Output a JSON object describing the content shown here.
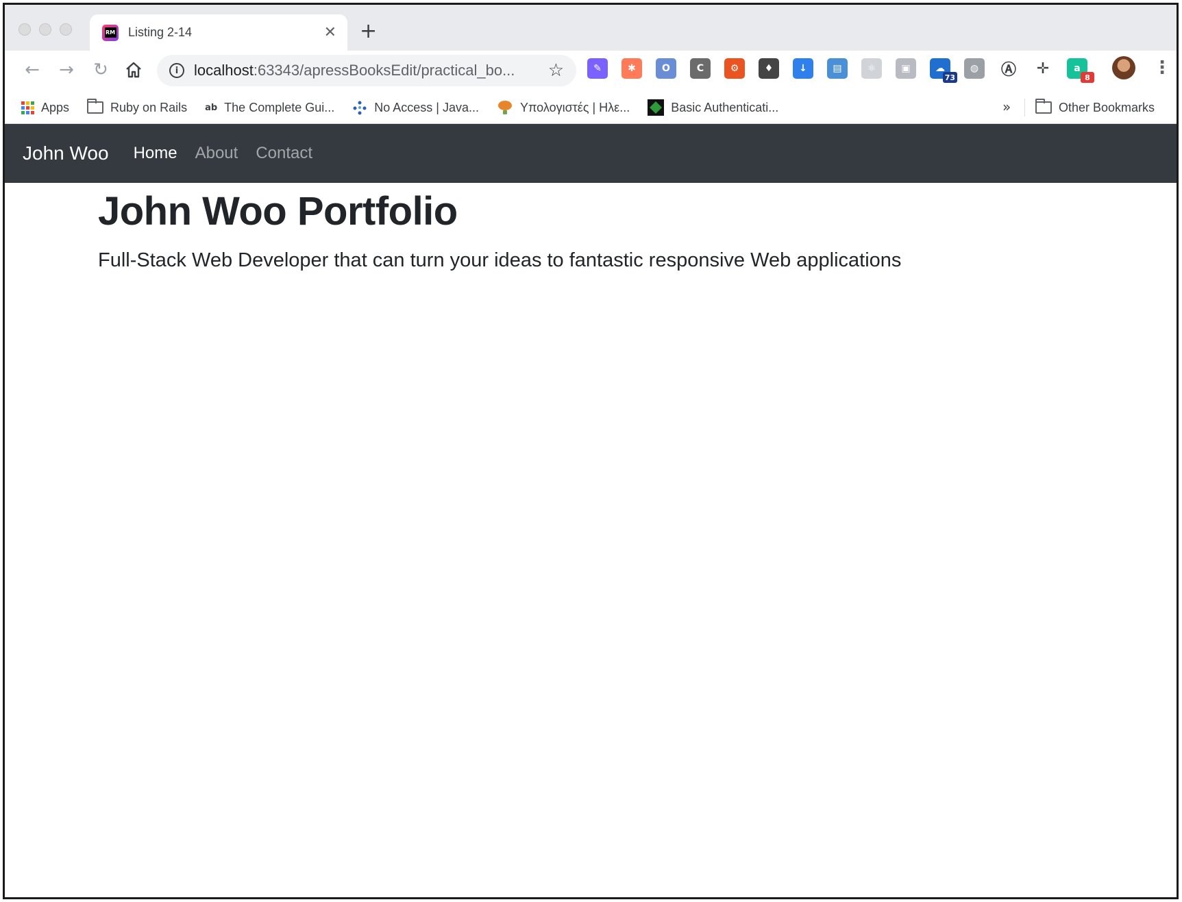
{
  "browser": {
    "tab": {
      "title": "Listing 2-14",
      "favicon_text": "RM",
      "close_glyph": "✕"
    },
    "new_tab_glyph": "+",
    "toolbar": {
      "back_icon": "arrow-left-icon",
      "forward_icon": "arrow-right-icon",
      "reload_icon": "reload-icon",
      "home_icon": "home-icon",
      "url_host": "localhost",
      "url_rest": ":63343/apressBooksEdit/practical_bo...",
      "star_icon": "star-icon",
      "extensions": [
        {
          "icon": "eyedropper-icon",
          "color": "#7b61ff",
          "text": "✎"
        },
        {
          "icon": "hubspot-icon",
          "color": "#ff7a59",
          "text": "✱"
        },
        {
          "icon": "opera-icon",
          "color": "#6a8ed6",
          "text": "O"
        },
        {
          "icon": "c-icon",
          "color": "#6b6b6b",
          "text": "C"
        },
        {
          "icon": "ubuntu-icon",
          "color": "#e95420",
          "text": "⚙"
        },
        {
          "icon": "lightbulb-icon",
          "color": "#444444",
          "text": "♦"
        },
        {
          "icon": "download-icon",
          "color": "#2f80ed",
          "text": "↓"
        },
        {
          "icon": "dashboard-icon",
          "color": "#4a90d9",
          "text": "▤"
        },
        {
          "icon": "react-icon",
          "color": "#d0d3d8",
          "text": "⚛"
        },
        {
          "icon": "camera-icon",
          "color": "#b8bcc2",
          "text": "▣"
        },
        {
          "icon": "cloud-icon",
          "color": "#1f6fd1",
          "text": "☁",
          "badge": "73",
          "badge_color": "#1a3a8f"
        },
        {
          "icon": "globe-icon",
          "color": "#9aa0a6",
          "text": "◍"
        },
        {
          "icon": "a-circle-icon",
          "color": "#ffffff",
          "text": "Ⓐ"
        },
        {
          "icon": "move-icon",
          "color": "#ffffff",
          "text": "✛"
        },
        {
          "icon": "grammarly-icon",
          "color": "#15c39a",
          "text": "a",
          "badge": "8",
          "badge_color": "#e53935"
        }
      ],
      "menu_glyph": "⋮"
    },
    "bookmarks": [
      {
        "label": "Apps",
        "icon": "apps-grid-icon"
      },
      {
        "label": "Ruby on Rails",
        "icon": "folder-icon"
      },
      {
        "label": "The Complete Gui...",
        "icon": "ab-icon"
      },
      {
        "label": "No Access | Java...",
        "icon": "network-icon"
      },
      {
        "label": "Υπολογιστές | Ηλε...",
        "icon": "balloon-icon"
      },
      {
        "label": "Basic Authenticati...",
        "icon": "diamond-icon"
      }
    ],
    "bookmarks_overflow": "»",
    "other_bookmarks": "Other Bookmarks"
  },
  "page": {
    "navbar": {
      "brand": "John Woo",
      "links": [
        {
          "label": "Home",
          "active": true
        },
        {
          "label": "About",
          "active": false
        },
        {
          "label": "Contact",
          "active": false
        }
      ]
    },
    "jumbotron": {
      "heading": "John Woo Portfolio",
      "lead": "Full-Stack Web Developer that can turn your ideas to fantastic responsive Web applications"
    }
  }
}
